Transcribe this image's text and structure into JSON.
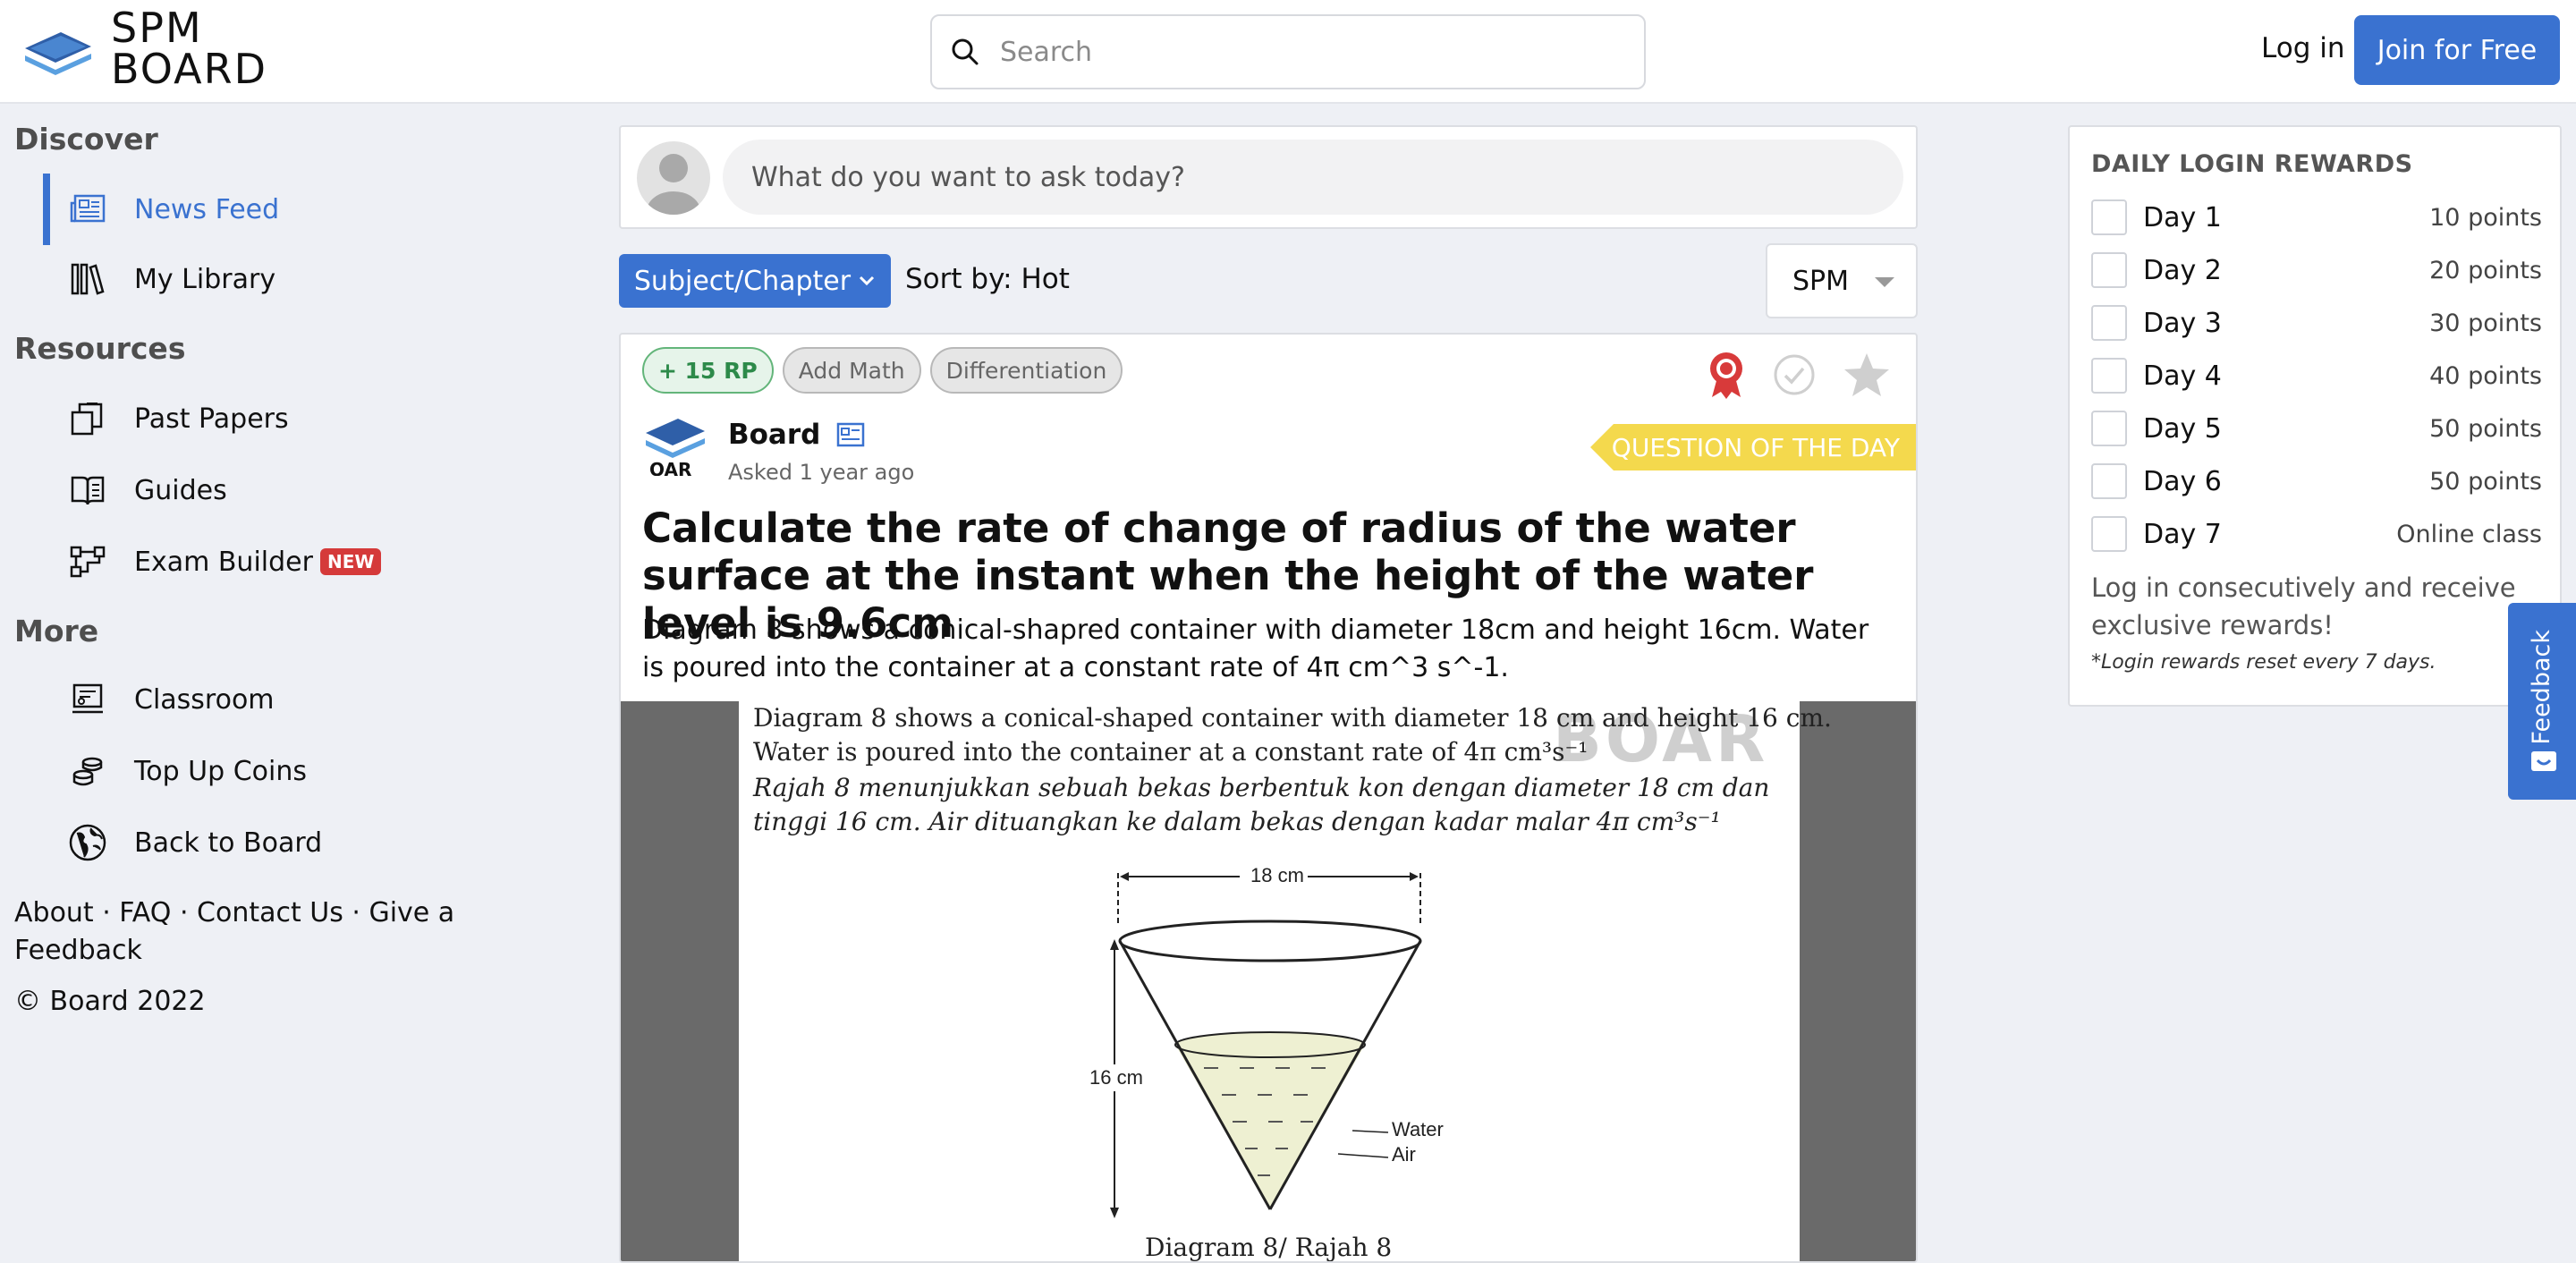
{
  "header": {
    "logo_line1": "SPM",
    "logo_line2": "BOARD",
    "search_placeholder": "Search",
    "login_label": "Log in",
    "join_label": "Join for Free"
  },
  "sidebar": {
    "discover_title": "Discover",
    "discover_items": [
      {
        "label": "News Feed",
        "icon": "newspaper-icon",
        "active": true
      },
      {
        "label": "My Library",
        "icon": "books-icon"
      }
    ],
    "resources_title": "Resources",
    "resources_items": [
      {
        "label": "Past Papers",
        "icon": "documents-icon"
      },
      {
        "label": "Guides",
        "icon": "guide-book-icon"
      },
      {
        "label": "Exam Builder",
        "icon": "builder-icon",
        "badge": "NEW"
      }
    ],
    "more_title": "More",
    "more_items": [
      {
        "label": "Classroom",
        "icon": "classroom-icon"
      },
      {
        "label": "Top Up Coins",
        "icon": "coins-icon"
      },
      {
        "label": "Back to Board",
        "icon": "globe-icon"
      }
    ],
    "footer_links": "About · FAQ · Contact Us · Give a Feedback",
    "copyright": "© Board 2022"
  },
  "ask": {
    "placeholder": "What do you want to ask today?"
  },
  "filters": {
    "subject_label": "Subject/Chapter",
    "sort_label": "Sort by: Hot",
    "level_value": "SPM"
  },
  "post": {
    "tags": [
      "+ 15 RP",
      "Add Math",
      "Differentiation"
    ],
    "author": "Board",
    "asked": "Asked 1 year ago",
    "qotd": "QUESTION OF THE DAY",
    "title": "Calculate the rate of change of radius of the water surface at the instant when the height of the water level is 9.6cm",
    "body": "Diagram 8 shows a conical-shapred container with diameter 18cm and height 16cm. Water is poured into the container at a constant rate of 4π cm^3 s^-1.",
    "image": {
      "line1": "Diagram 8 shows a conical-shaped container with diameter 18 cm and height 16 cm.",
      "line2": "Water is poured into the container at a constant rate of 4π cm³s⁻¹",
      "line3": "Rajah 8 menunjukkan sebuah bekas berbentuk kon dengan diameter 18 cm dan",
      "line4": "tinggi 16 cm. Air dituangkan ke dalam bekas dengan kadar malar 4π cm³s⁻¹",
      "dim_top": "18 cm",
      "dim_side": "16 cm",
      "label_water": "Water",
      "label_air": "Air",
      "caption": "Diagram 8/ Rajah 8",
      "watermark": "BOAR"
    }
  },
  "rewards": {
    "title": "DAILY LOGIN REWARDS",
    "days": [
      {
        "label": "Day 1",
        "reward": "10 points"
      },
      {
        "label": "Day 2",
        "reward": "20 points"
      },
      {
        "label": "Day 3",
        "reward": "30 points"
      },
      {
        "label": "Day 4",
        "reward": "40 points"
      },
      {
        "label": "Day 5",
        "reward": "50 points"
      },
      {
        "label": "Day 6",
        "reward": "50 points"
      },
      {
        "label": "Day 7",
        "reward": "Online class"
      }
    ],
    "note": "Log in consecutively and receive exclusive rewards!",
    "sub": "*Login rewards reset every 7 days."
  },
  "feedback_tab": "Feedback",
  "colors": {
    "accent": "#3a72d0",
    "qotd": "#f4d94d",
    "new_badge": "#d53a3a",
    "rp_green": "#2d8a4a"
  }
}
